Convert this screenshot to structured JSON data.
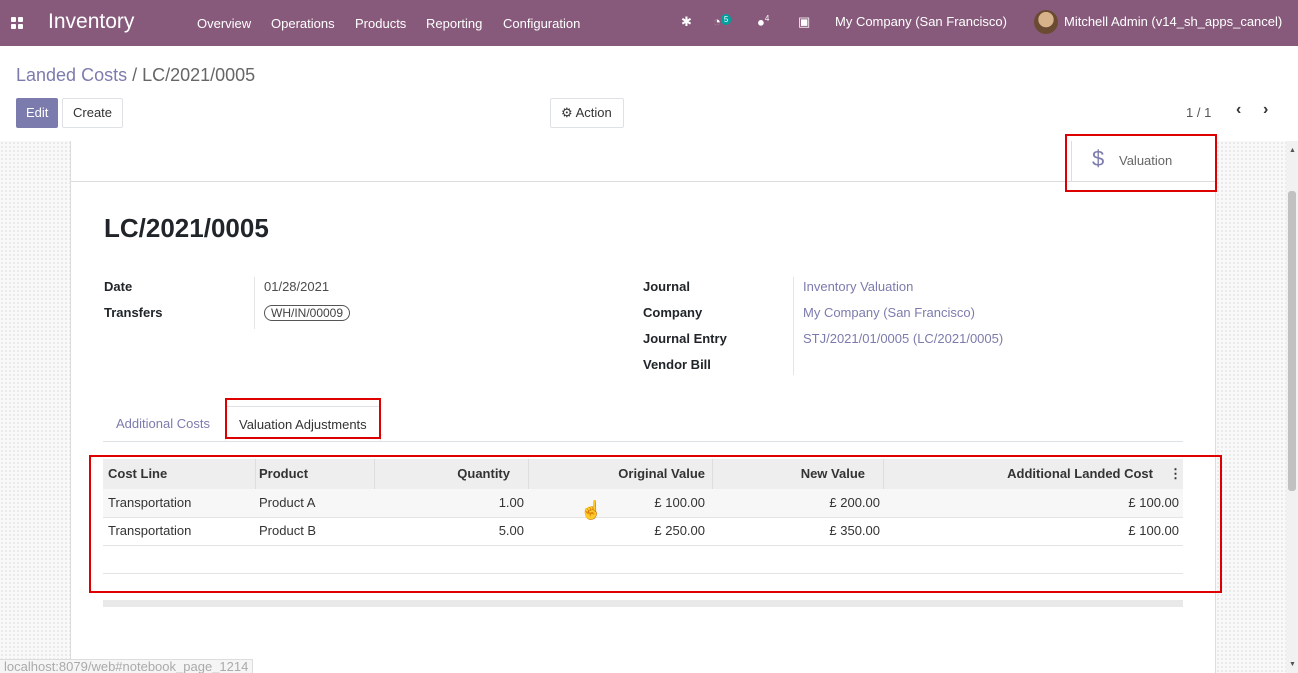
{
  "app": {
    "brand": "Inventory",
    "menu": [
      "Overview",
      "Operations",
      "Products",
      "Reporting",
      "Configuration"
    ],
    "activity_count": "5",
    "messages_count": "4",
    "company": "My Company (San Francisco)",
    "user": "Mitchell Admin (v14_sh_apps_cancel)"
  },
  "control_panel": {
    "breadcrumb_parent": "Landed Costs",
    "breadcrumb_sep": " / ",
    "breadcrumb_current": "LC/2021/0005",
    "edit_label": "Edit",
    "create_label": "Create",
    "action_label": "Action",
    "pager": "1 / 1"
  },
  "smart_button": {
    "icon": "$",
    "label": "Valuation"
  },
  "form": {
    "title": "LC/2021/0005",
    "left": [
      {
        "label": "Date",
        "value": "01/28/2021"
      },
      {
        "label": "Transfers",
        "value": "WH/IN/00009"
      }
    ],
    "right": [
      {
        "label": "Journal",
        "value": "Inventory Valuation"
      },
      {
        "label": "Company",
        "value": "My Company (San Francisco)"
      },
      {
        "label": "Journal Entry",
        "value": "STJ/2021/01/0005 (LC/2021/0005)"
      },
      {
        "label": "Vendor Bill",
        "value": ""
      }
    ]
  },
  "tabs": [
    {
      "label": "Additional Costs",
      "active": false
    },
    {
      "label": "Valuation Adjustments",
      "active": true
    }
  ],
  "table": {
    "headers": [
      "Cost Line",
      "Product",
      "Quantity",
      "Original Value",
      "New Value",
      "Additional Landed Cost"
    ],
    "rows": [
      [
        "Transportation",
        "Product A",
        "1.00",
        "£ 100.00",
        "£ 200.00",
        "£ 100.00"
      ],
      [
        "Transportation",
        "Product B",
        "5.00",
        "£ 250.00",
        "£ 350.00",
        "£ 100.00"
      ]
    ]
  },
  "status_url": "localhost:8079/web#notebook_page_1214",
  "colors": {
    "navbar": "#875a7b",
    "primary": "#7c7bad",
    "highlight": "#dd0000"
  }
}
